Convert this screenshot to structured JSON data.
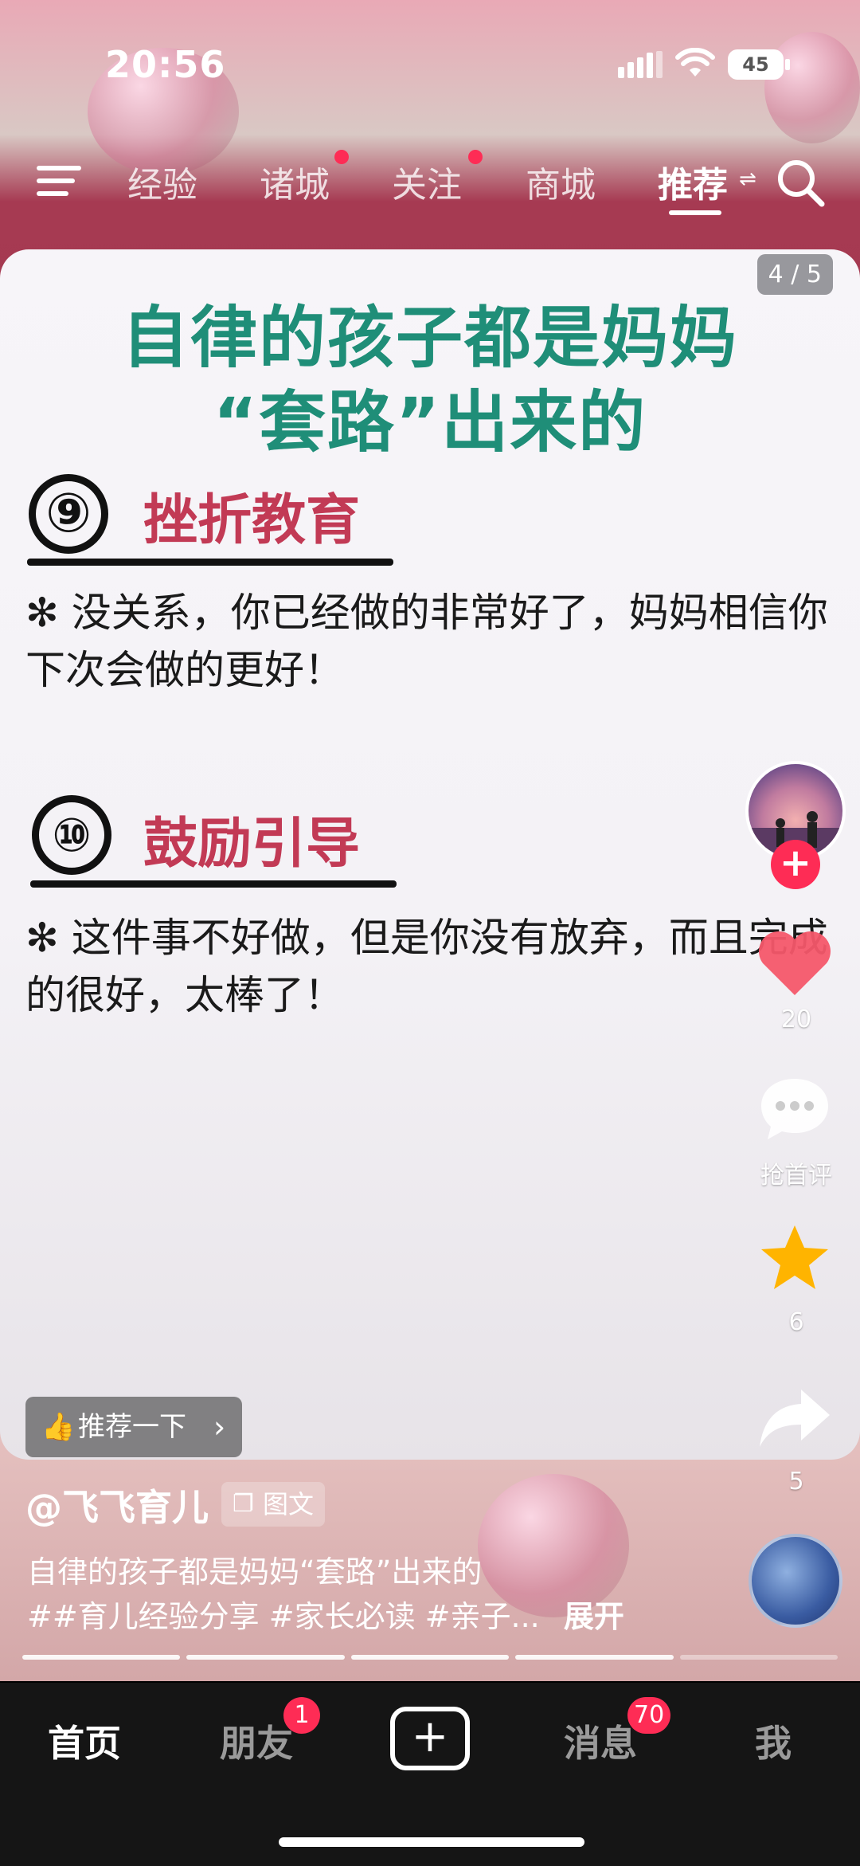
{
  "status_bar": {
    "time": "20:56",
    "battery": "45"
  },
  "top_tabs": [
    {
      "label": "经验",
      "dot": false
    },
    {
      "label": "诸城",
      "dot": true
    },
    {
      "label": "关注",
      "dot": true
    },
    {
      "label": "商城",
      "dot": false
    },
    {
      "label": "推荐",
      "dot": false,
      "active": true
    }
  ],
  "post": {
    "page_indicator": "4 / 5",
    "title_line1": "自律的孩子都是妈妈",
    "title_line2": "“套路”出来的",
    "sections": [
      {
        "number": "⑨",
        "title": "挫折教育",
        "text": "✻ 没关系，你已经做的非常好了，妈妈相信你下次会做的更好！"
      },
      {
        "number": "⑩",
        "title": "鼓励引导",
        "text": "✻ 这件事不好做，但是你没有放弃，而且完成的很好，太棒了！"
      }
    ],
    "recommend_label": "推荐一下"
  },
  "actions": {
    "like_count": "20",
    "comment_label": "抢首评",
    "favorite_count": "6",
    "share_count": "5"
  },
  "info": {
    "author": "@飞飞育儿",
    "type_badge": "图文",
    "caption_line1": "自律的孩子都是妈妈“套路”出来的",
    "caption_line2": "##育儿经验分享 #家长必读 #亲子...",
    "expand_label": "展开"
  },
  "progress": {
    "total_pages": 5,
    "current_page": 4
  },
  "bottom_nav": [
    {
      "label": "首页",
      "active": true
    },
    {
      "label": "朋友",
      "badge": "1"
    },
    {
      "label": "消息",
      "badge": "70"
    },
    {
      "label": "我"
    }
  ],
  "colors": {
    "accent": "#fe2c55",
    "title_green": "#1f8e78",
    "section_red": "#c23a55",
    "star": "#ffb400"
  }
}
